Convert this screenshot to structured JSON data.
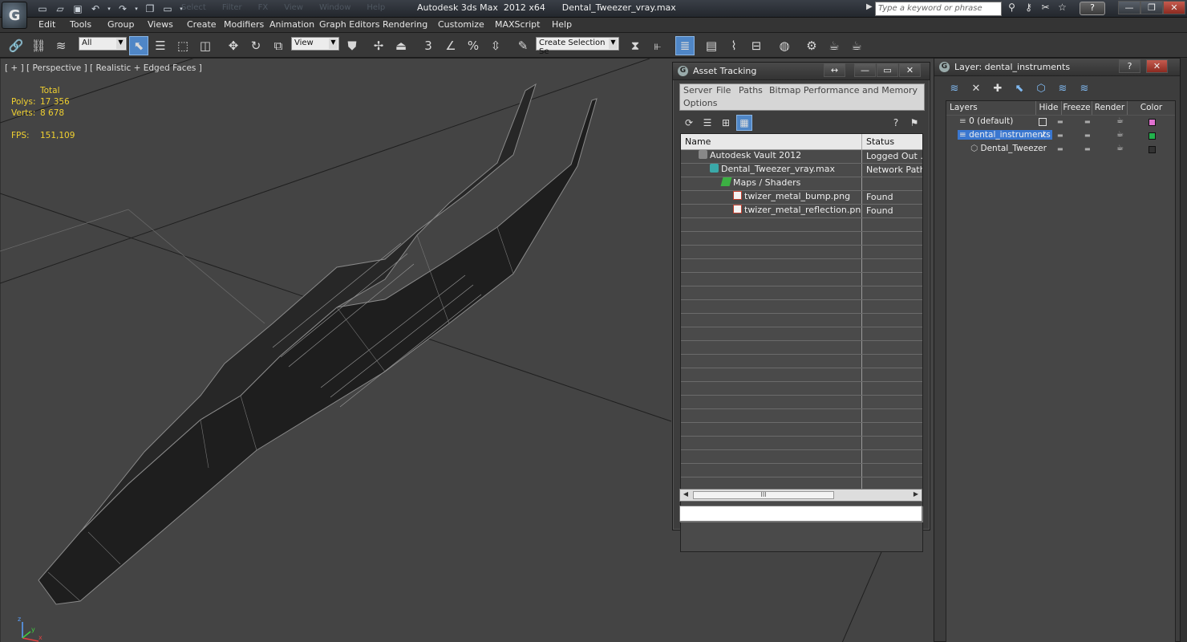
{
  "app": {
    "logo_letter": "G",
    "title": "Autodesk 3ds Max  2012 x64      Dental_Tweezer_vray.max",
    "search_placeholder": "Type a keyword or phrase",
    "help_label": "?"
  },
  "quick_access": [
    "new-icon",
    "open-icon",
    "save-icon",
    "undo-icon",
    "redo-icon",
    "project-icon",
    "layout-icon"
  ],
  "ghost_menu": [
    "Select",
    "Filter",
    "FX",
    "View",
    "Window",
    "Help"
  ],
  "menu": [
    "Edit",
    "Tools",
    "Group",
    "Views",
    "Create",
    "Modifiers",
    "Animation",
    "Graph Editors",
    "Rendering",
    "Customize",
    "MAXScript",
    "Help"
  ],
  "toolbar": {
    "filter_value": "All",
    "refcoord_value": "View",
    "selection_set_value": "Create Selection Se"
  },
  "viewport": {
    "label": "[ + ] [ Perspective ] [ Realistic + Edged Faces ]",
    "stats_header": "Total",
    "stats": [
      {
        "key": "Polys:",
        "value": "17 356"
      },
      {
        "key": "Verts:",
        "value": "8 678"
      }
    ],
    "fps_key": "FPS:",
    "fps_value": "151,109",
    "axis": {
      "x": "x",
      "y": "y",
      "z": "z"
    }
  },
  "asset_tracking": {
    "title": "Asset Tracking",
    "menu_row1": [
      "Server",
      "File",
      "Paths",
      "Bitmap Performance and Memory"
    ],
    "menu_row2": [
      "Options"
    ],
    "columns": [
      "Name",
      "Status"
    ],
    "rows": [
      {
        "name": "Autodesk Vault 2012",
        "status": "Logged Out ...",
        "indent": 1,
        "icon": "vault-icon"
      },
      {
        "name": "Dental_Tweezer_vray.max",
        "status": "Network Path",
        "indent": 2,
        "icon": "max-file-icon"
      },
      {
        "name": "Maps / Shaders",
        "status": "",
        "indent": 3,
        "icon": "maps-icon"
      },
      {
        "name": "twizer_metal_bump.png",
        "status": "Found",
        "indent": 4,
        "icon": "image-file-icon"
      },
      {
        "name": "twizer_metal_reflection.png",
        "status": "Found",
        "indent": 4,
        "icon": "image-file-icon"
      }
    ],
    "empty_rows": 20,
    "scroll_thumb_label": "III"
  },
  "layer_manager": {
    "title": "Layer: dental_instruments",
    "columns": [
      "Layers",
      "Hide",
      "Freeze",
      "Render",
      "Color"
    ],
    "rows": [
      {
        "name": "0 (default)",
        "selected": false,
        "current": true,
        "color": "#e070d0"
      },
      {
        "name": "dental_instruments",
        "selected": true,
        "active_check": true,
        "color": "#22b24c"
      },
      {
        "name": "Dental_Tweezer",
        "selected": false,
        "child": true,
        "color": "#333333"
      }
    ]
  },
  "colors": {
    "accent": "#4f86c6",
    "stats_yellow": "#f0d030",
    "viewport_bg": "#444444",
    "selection": "#3a77d0"
  }
}
